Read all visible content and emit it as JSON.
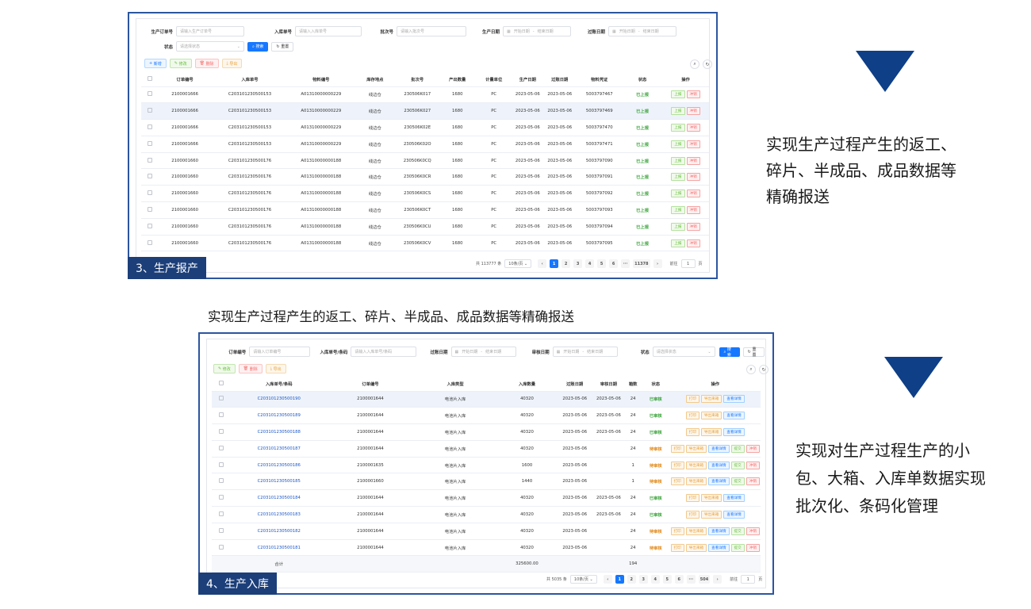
{
  "panel1": {
    "filters": {
      "order_label": "生产订单号",
      "order_ph": "请输入生产订单号",
      "inbound_label": "入库单号",
      "inbound_ph": "请输入入库单号",
      "batch_label": "批次号",
      "batch_ph": "请输入批次号",
      "proddate_label": "生产日期",
      "start_ph": "开始日期",
      "sep": "-",
      "end_ph": "结束日期",
      "postdate_label": "过账日期",
      "status_label": "状态",
      "status_ph": "请选择状态",
      "search": "搜索",
      "reset": "重置"
    },
    "toolbar": {
      "add": "新增",
      "edit": "修改",
      "delete": "删除",
      "export": "导出"
    },
    "columns": [
      "订单编号",
      "入库单号",
      "物料编号",
      "库存地点",
      "批次号",
      "产出数量",
      "计量单位",
      "生产日期",
      "过账日期",
      "物料凭证",
      "状态",
      "操作"
    ],
    "rows": [
      [
        "2100001666",
        "C203101230500153",
        "A01310000000229",
        "线边仓",
        "230506K017",
        "1680",
        "PC",
        "2023-05-06",
        "2023-05-06",
        "5003797467",
        "已上报"
      ],
      [
        "2100001666",
        "C203101230500153",
        "A01310000000229",
        "线边仓",
        "230506K027",
        "1680",
        "PC",
        "2023-05-06",
        "2023-05-06",
        "5003797469",
        "已上报"
      ],
      [
        "2100001666",
        "C203101230500153",
        "A01310000000229",
        "线边仓",
        "230506K02E",
        "1680",
        "PC",
        "2023-05-06",
        "2023-05-06",
        "5003797470",
        "已上报"
      ],
      [
        "2100001666",
        "C203101230500153",
        "A01310000000229",
        "线边仓",
        "230506K02O",
        "1680",
        "PC",
        "2023-05-06",
        "2023-05-06",
        "5003797471",
        "已上报"
      ],
      [
        "2100001660",
        "C203101230500176",
        "A01310000000188",
        "线边仓",
        "230506K0CQ",
        "1680",
        "PC",
        "2023-05-06",
        "2023-05-06",
        "5003797090",
        "已上报"
      ],
      [
        "2100001660",
        "C203101230500176",
        "A01310000000188",
        "线边仓",
        "230506K0CR",
        "1680",
        "PC",
        "2023-05-06",
        "2023-05-06",
        "5003797091",
        "已上报"
      ],
      [
        "2100001660",
        "C203101230500176",
        "A01310000000188",
        "线边仓",
        "230506K0CS",
        "1680",
        "PC",
        "2023-05-06",
        "2023-05-06",
        "5003797092",
        "已上报"
      ],
      [
        "2100001660",
        "C203101230500176",
        "A01310000000188",
        "线边仓",
        "230506K0CT",
        "1680",
        "PC",
        "2023-05-06",
        "2023-05-06",
        "5003797093",
        "已上报"
      ],
      [
        "2100001660",
        "C203101230500176",
        "A01310000000188",
        "线边仓",
        "230506K0CU",
        "1680",
        "PC",
        "2023-05-06",
        "2023-05-06",
        "5003797094",
        "已上报"
      ],
      [
        "2100001660",
        "C203101230500176",
        "A01310000000188",
        "线边仓",
        "230506K0CV",
        "1680",
        "PC",
        "2023-05-06",
        "2023-05-06",
        "5003797095",
        "已上报"
      ]
    ],
    "actions": {
      "report": "上报",
      "reverse": "冲销"
    },
    "pager": {
      "total": "共 113777 条",
      "size": "10条/页",
      "pages": [
        "1",
        "2",
        "3",
        "4",
        "5",
        "6",
        "···",
        "11378"
      ],
      "goto": "前往",
      "page": "1",
      "page_unit": "页"
    },
    "tag": "3、生产报产"
  },
  "caption_mid": "实现生产过程产生的返工、碎片、半成品、成品数据等精确报送",
  "right1": [
    "实现生产过程产生的返工、",
    "碎片、半成品、成品数据等",
    "精确报送"
  ],
  "panel2": {
    "filters": {
      "order_label": "订单编号",
      "order_ph": "请输入订单编号",
      "inbound_label": "入库单号/条码",
      "inbound_ph": "请输入入库单号/条码",
      "postdate_label": "过账日期",
      "start_ph": "开始日期",
      "sep": "-",
      "end_ph": "结束日期",
      "auditdate_label": "审核日期",
      "status_label": "状态",
      "status_ph": "请选择状态",
      "search": "搜索",
      "reset": "重置"
    },
    "toolbar": {
      "edit": "修改",
      "delete": "删除",
      "export": "导出"
    },
    "columns": [
      "入库单号/条码",
      "订单编号",
      "入库类型",
      "入库数量",
      "过账日期",
      "审核日期",
      "箱数",
      "状态",
      "操作"
    ],
    "rows": [
      [
        "C203101230500190",
        "2100001644",
        "电池片入库",
        "40320",
        "2023-05-06",
        "2023-05-06",
        "24",
        "已审核"
      ],
      [
        "C203101230500189",
        "2100001644",
        "电池片入库",
        "40320",
        "2023-05-06",
        "2023-05-06",
        "24",
        "已审核"
      ],
      [
        "C203101230500188",
        "2100001644",
        "电池片入库",
        "40320",
        "2023-05-06",
        "2023-05-06",
        "24",
        "已审核"
      ],
      [
        "C203101230500187",
        "2100001644",
        "电池片入库",
        "40320",
        "2023-05-06",
        "",
        "24",
        "待审核"
      ],
      [
        "C203101230500186",
        "2100001635",
        "电池片入库",
        "1600",
        "2023-05-06",
        "",
        "1",
        "待审核"
      ],
      [
        "C203101230500185",
        "2100001660",
        "电池片入库",
        "1440",
        "2023-05-06",
        "",
        "1",
        "待审核"
      ],
      [
        "C203101230500184",
        "2100001644",
        "电池片入库",
        "40320",
        "2023-05-06",
        "2023-05-06",
        "24",
        "已审核"
      ],
      [
        "C203101230500183",
        "2100001644",
        "电池片入库",
        "40320",
        "2023-05-06",
        "2023-05-06",
        "24",
        "已审核"
      ],
      [
        "C203101230500182",
        "2100001644",
        "电池片入库",
        "40320",
        "2023-05-06",
        "",
        "24",
        "待审核"
      ],
      [
        "C203101230500181",
        "2100001644",
        "电池片入库",
        "40320",
        "2023-05-06",
        "",
        "24",
        "待审核"
      ]
    ],
    "actions": {
      "print": "打印",
      "export_box": "导出来箱",
      "detail": "查看详情",
      "submit": "提交",
      "reverse": "冲销"
    },
    "total": {
      "label": "合计",
      "qty": "325600.00",
      "boxes": "194"
    },
    "pager": {
      "total": "共 5035 条",
      "size": "10条/页",
      "pages": [
        "1",
        "2",
        "3",
        "4",
        "5",
        "6",
        "···",
        "504"
      ],
      "goto": "前往",
      "page": "1",
      "page_unit": "页"
    },
    "tag": "4、生产入库"
  },
  "right2": [
    "实现对生产过程生产的小",
    "包、大箱、入库单数据实现",
    "批次化、条码化管理"
  ],
  "colors": {
    "frame": "#2b56a0",
    "tag_bg": "#1c3f7a",
    "triangle": "#0e3f87",
    "primary": "#1677ff"
  }
}
